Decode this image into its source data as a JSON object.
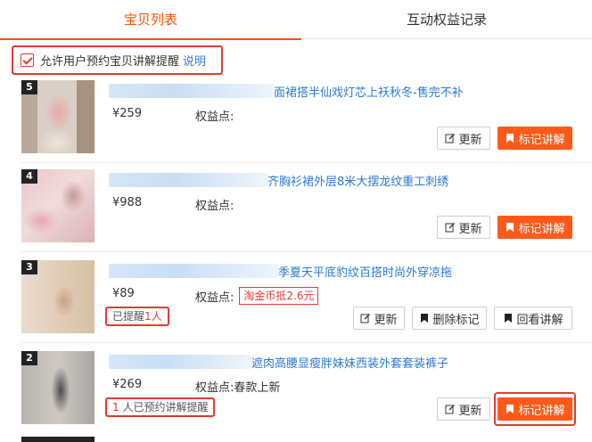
{
  "tabs": [
    {
      "label": "宝贝列表",
      "active": true
    },
    {
      "label": "互动权益记录",
      "active": false
    }
  ],
  "option": {
    "checked": true,
    "label": "允许用户预约宝贝讲解提醒",
    "help": "说明"
  },
  "items": [
    {
      "rank": "5",
      "title": "面裙搭半仙戏灯芯上袄秋冬-售完不补",
      "price": "¥259",
      "rights_label": "权益点:",
      "rights_value": "",
      "buttons": {
        "update": "更新",
        "mark": "标记讲解"
      }
    },
    {
      "rank": "4",
      "title": "齐胸衫裙外层8米大摆龙纹重工刺绣",
      "price": "¥988",
      "rights_label": "权益点:",
      "rights_value": "",
      "buttons": {
        "update": "更新",
        "mark": "标记讲解"
      }
    },
    {
      "rank": "3",
      "title": "季夏天平底豹纹百搭时尚外穿凉拖",
      "price": "¥89",
      "rights_label": "权益点:",
      "rights_value": "淘金币抵2.6元",
      "reminded": "已提醒",
      "reminded_count": "1人",
      "buttons": {
        "update": "更新",
        "unmark": "删除标记",
        "replay": "回看讲解"
      }
    },
    {
      "rank": "2",
      "title": "遮肉高腰显瘦胖妹妹西装外套套装裤子",
      "price": "¥269",
      "rights_label": "权益点:",
      "rights_value": "春款上新",
      "reserved_count": "1",
      "reserved_text": "人已预约讲解提醒",
      "buttons": {
        "update": "更新",
        "mark": "标记讲解"
      }
    }
  ],
  "colors": {
    "accent": "#ff5000",
    "button_orange": "#ff5a1a",
    "link": "#2a7ad5",
    "highlight": "#e53935"
  }
}
